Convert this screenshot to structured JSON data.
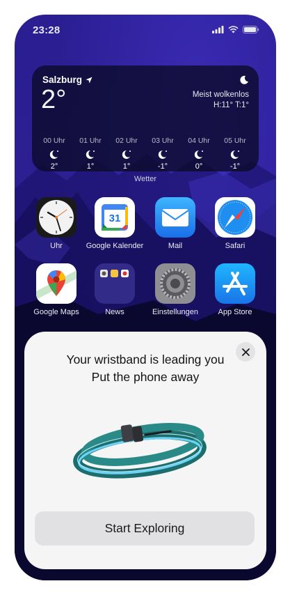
{
  "status_bar": {
    "time": "23:28"
  },
  "weather_widget": {
    "city": "Salzburg",
    "temperature": "2°",
    "condition": "Meist wolkenlos",
    "high_low": "H:11° T:1°",
    "hours": [
      {
        "label": "00 Uhr",
        "temp": "2°"
      },
      {
        "label": "01 Uhr",
        "temp": "1°"
      },
      {
        "label": "02 Uhr",
        "temp": "1°"
      },
      {
        "label": "03 Uhr",
        "temp": "-1°"
      },
      {
        "label": "04 Uhr",
        "temp": "0°"
      },
      {
        "label": "05 Uhr",
        "temp": "-1°"
      }
    ],
    "widget_label": "Wetter"
  },
  "apps": [
    {
      "label": "Uhr",
      "icon": "clock-icon"
    },
    {
      "label": "Google Kalender",
      "icon": "google-calendar-icon",
      "badge_text": "31"
    },
    {
      "label": "Mail",
      "icon": "mail-icon"
    },
    {
      "label": "Safari",
      "icon": "safari-icon"
    },
    {
      "label": "Google Maps",
      "icon": "google-maps-icon"
    },
    {
      "label": "News",
      "icon": "folder-icon"
    },
    {
      "label": "Einstellungen",
      "icon": "settings-gear-icon"
    },
    {
      "label": "App Store",
      "icon": "app-store-icon"
    }
  ],
  "sheet": {
    "title_line1": "Your wristband is leading you",
    "title_line2": "Put the phone away",
    "close_icon": "close-icon",
    "cta_label": "Start Exploring"
  },
  "colors": {
    "wallpaper": "#2a1e93",
    "sheet_bg": "#f5f5f6",
    "cta_bg": "#e1e1e3",
    "band_teal": "#1f6f6e",
    "band_glow": "#5fd3ff"
  }
}
